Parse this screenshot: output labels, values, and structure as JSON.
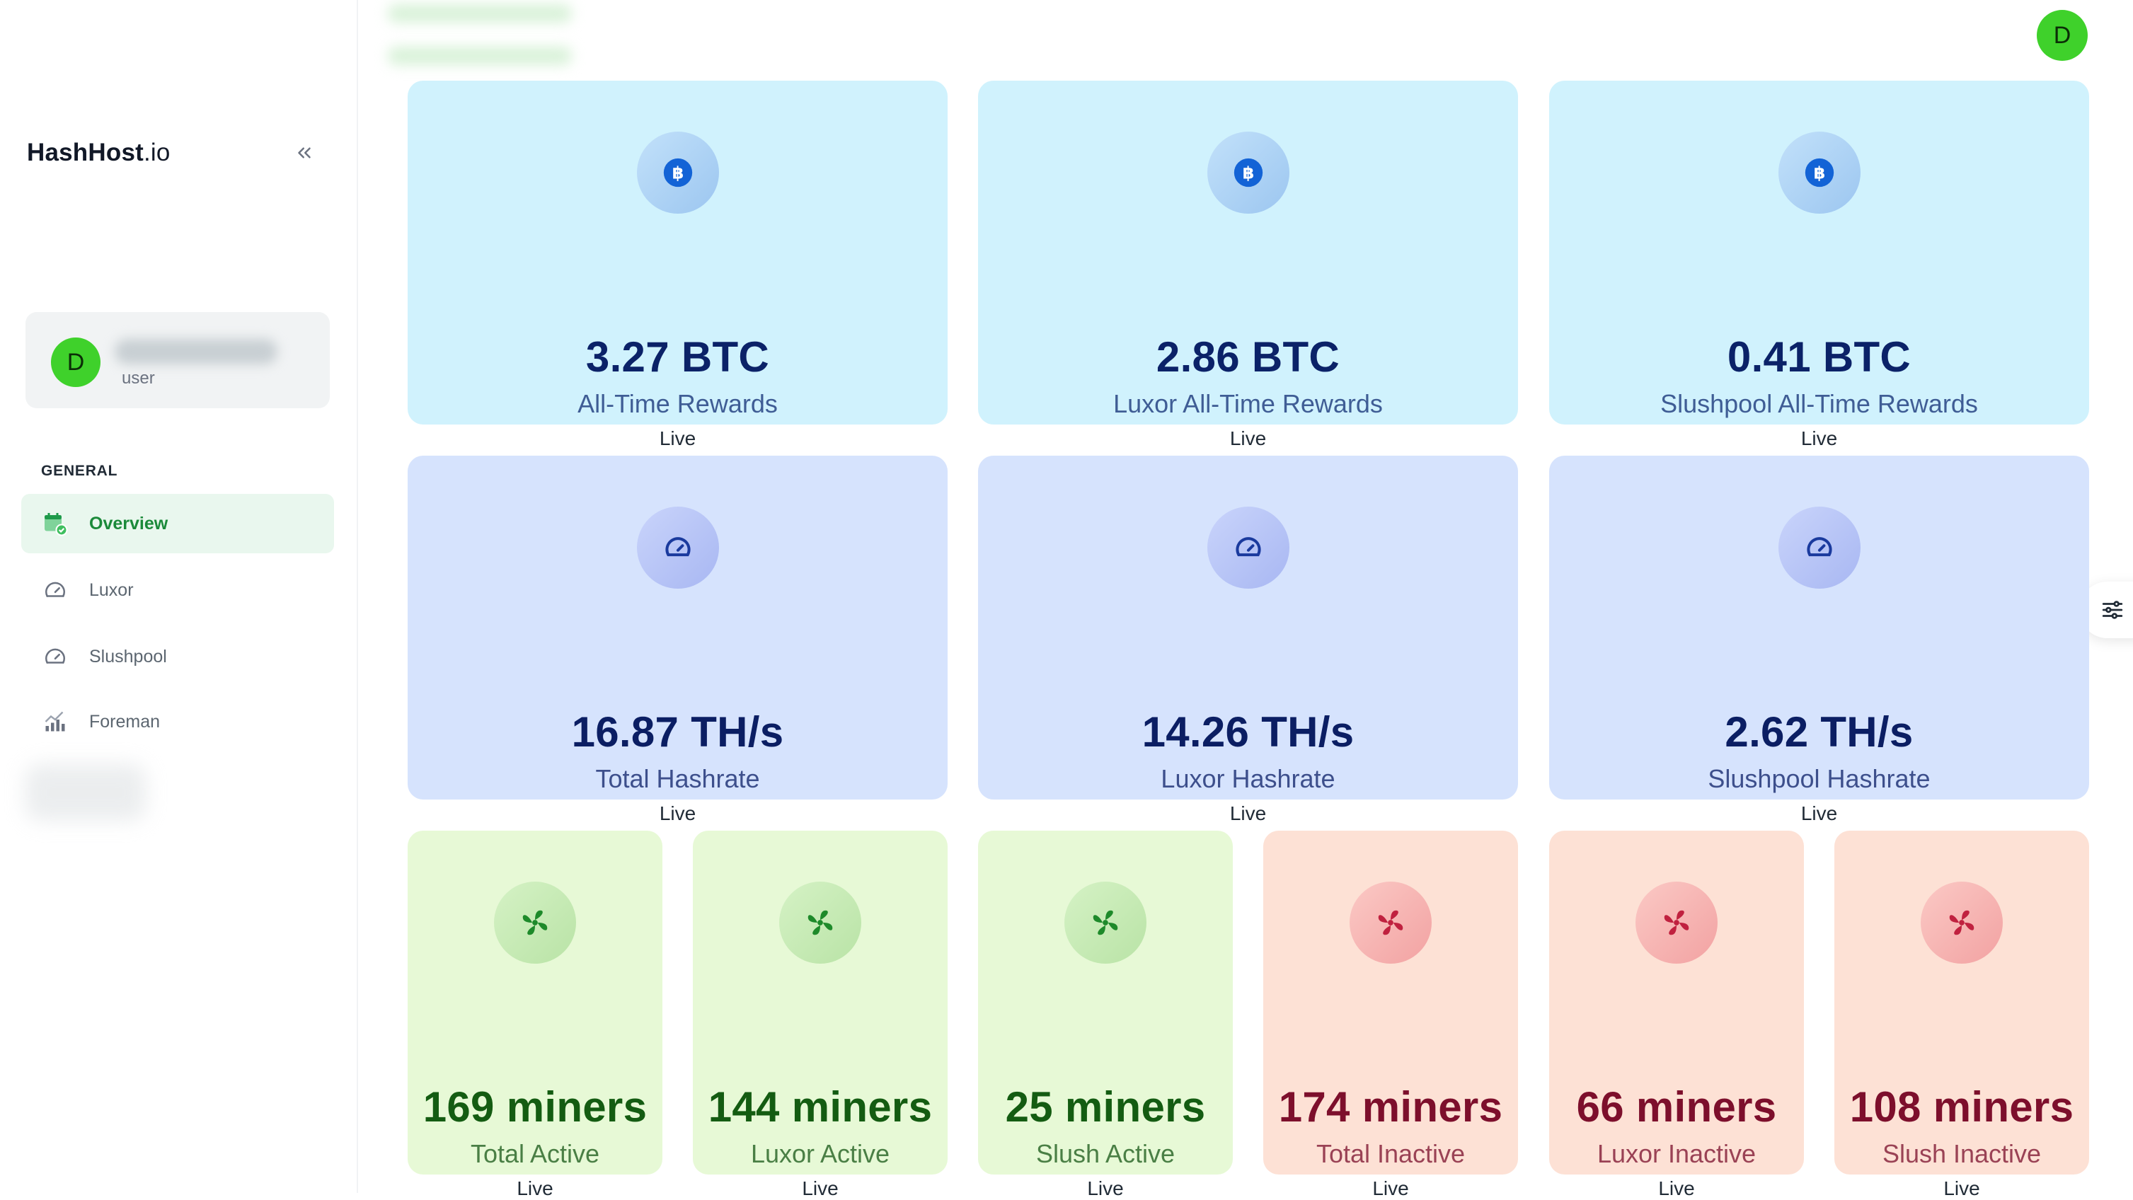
{
  "app": {
    "logo_bold": "HashHost",
    "logo_light": ".io"
  },
  "user": {
    "avatar_initial": "D",
    "role": "user"
  },
  "nav": {
    "heading": "GENERAL",
    "items": [
      {
        "label": "Overview",
        "icon": "calendar-check-icon",
        "active": true
      },
      {
        "label": "Luxor",
        "icon": "speedometer-icon",
        "active": false
      },
      {
        "label": "Slushpool",
        "icon": "speedometer-icon",
        "active": false
      },
      {
        "label": "Foreman",
        "icon": "bar-chart-icon",
        "active": false
      }
    ]
  },
  "header": {
    "avatar_initial": "D"
  },
  "colors": {
    "accent_green": "#3fd12b",
    "rewards_card": "#d0f2fd",
    "hashrate_card": "#d6e3fd",
    "active_card": "#e7f9d6",
    "inactive_card": "#fde1d5"
  },
  "rewards": [
    {
      "value": "3.27 BTC",
      "label": "All-Time Rewards",
      "status": "Live",
      "icon": "bitcoin-icon"
    },
    {
      "value": "2.86 BTC",
      "label": "Luxor All-Time Rewards",
      "status": "Live",
      "icon": "bitcoin-icon"
    },
    {
      "value": "0.41 BTC",
      "label": "Slushpool All-Time Rewards",
      "status": "Live",
      "icon": "bitcoin-icon"
    }
  ],
  "hashrate": [
    {
      "value": "16.87 TH/s",
      "label": "Total Hashrate",
      "status": "Live",
      "icon": "speedometer-icon"
    },
    {
      "value": "14.26 TH/s",
      "label": "Luxor Hashrate",
      "status": "Live",
      "icon": "speedometer-icon"
    },
    {
      "value": "2.62 TH/s",
      "label": "Slushpool Hashrate",
      "status": "Live",
      "icon": "speedometer-icon"
    }
  ],
  "miners": [
    {
      "value": "169 miners",
      "label": "Total Active",
      "status": "Live",
      "icon": "fan-icon",
      "state": "active"
    },
    {
      "value": "144 miners",
      "label": "Luxor Active",
      "status": "Live",
      "icon": "fan-icon",
      "state": "active"
    },
    {
      "value": "25 miners",
      "label": "Slush Active",
      "status": "Live",
      "icon": "fan-icon",
      "state": "active"
    },
    {
      "value": "174 miners",
      "label": "Total Inactive",
      "status": "Live",
      "icon": "fan-icon",
      "state": "inactive"
    },
    {
      "value": "66 miners",
      "label": "Luxor Inactive",
      "status": "Live",
      "icon": "fan-icon",
      "state": "inactive"
    },
    {
      "value": "108 miners",
      "label": "Slush Inactive",
      "status": "Live",
      "icon": "fan-icon",
      "state": "inactive"
    }
  ]
}
